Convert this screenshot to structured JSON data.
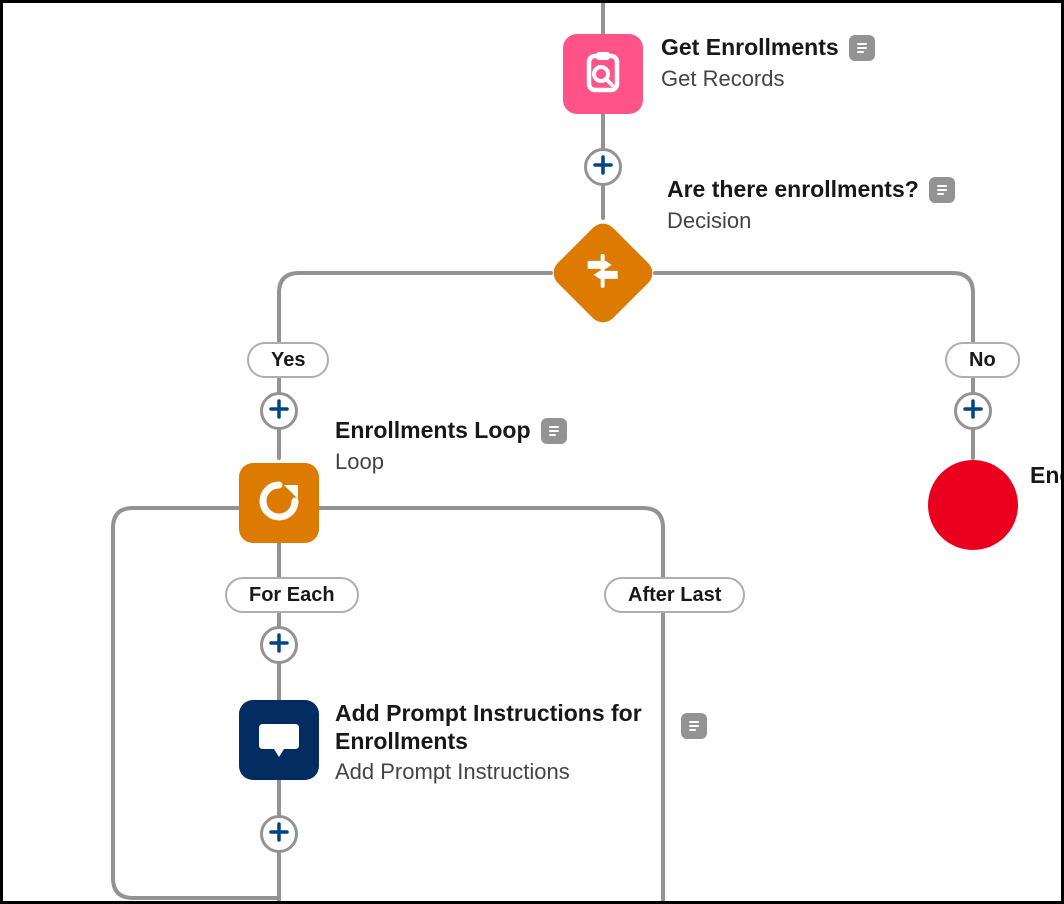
{
  "colors": {
    "pink": "#ff538a",
    "orange": "#dd7a01",
    "navy": "#032d60",
    "red": "#ea001e",
    "connector": "#939393",
    "plus": "#014486"
  },
  "icons": {
    "clipboard_search": "clipboard-search-icon",
    "signpost": "signpost-icon",
    "loop_refresh": "loop-refresh-icon",
    "chat_bubble": "chat-bubble-icon",
    "stop": "stop-icon",
    "plus": "plus-icon",
    "description": "description-icon"
  },
  "nodes": {
    "get_enrollments": {
      "title": "Get Enrollments",
      "subtitle": "Get Records"
    },
    "decision": {
      "title": "Are there enrollments?",
      "subtitle": "Decision"
    },
    "loop": {
      "title": "Enrollments Loop",
      "subtitle": "Loop"
    },
    "add_prompt": {
      "title": "Add Prompt Instructions for Enrollments",
      "subtitle": "Add Prompt Instructions"
    },
    "end": {
      "title": "End"
    }
  },
  "outcomes": {
    "yes": "Yes",
    "no": "No",
    "for_each": "For Each",
    "after_last": "After Last"
  }
}
